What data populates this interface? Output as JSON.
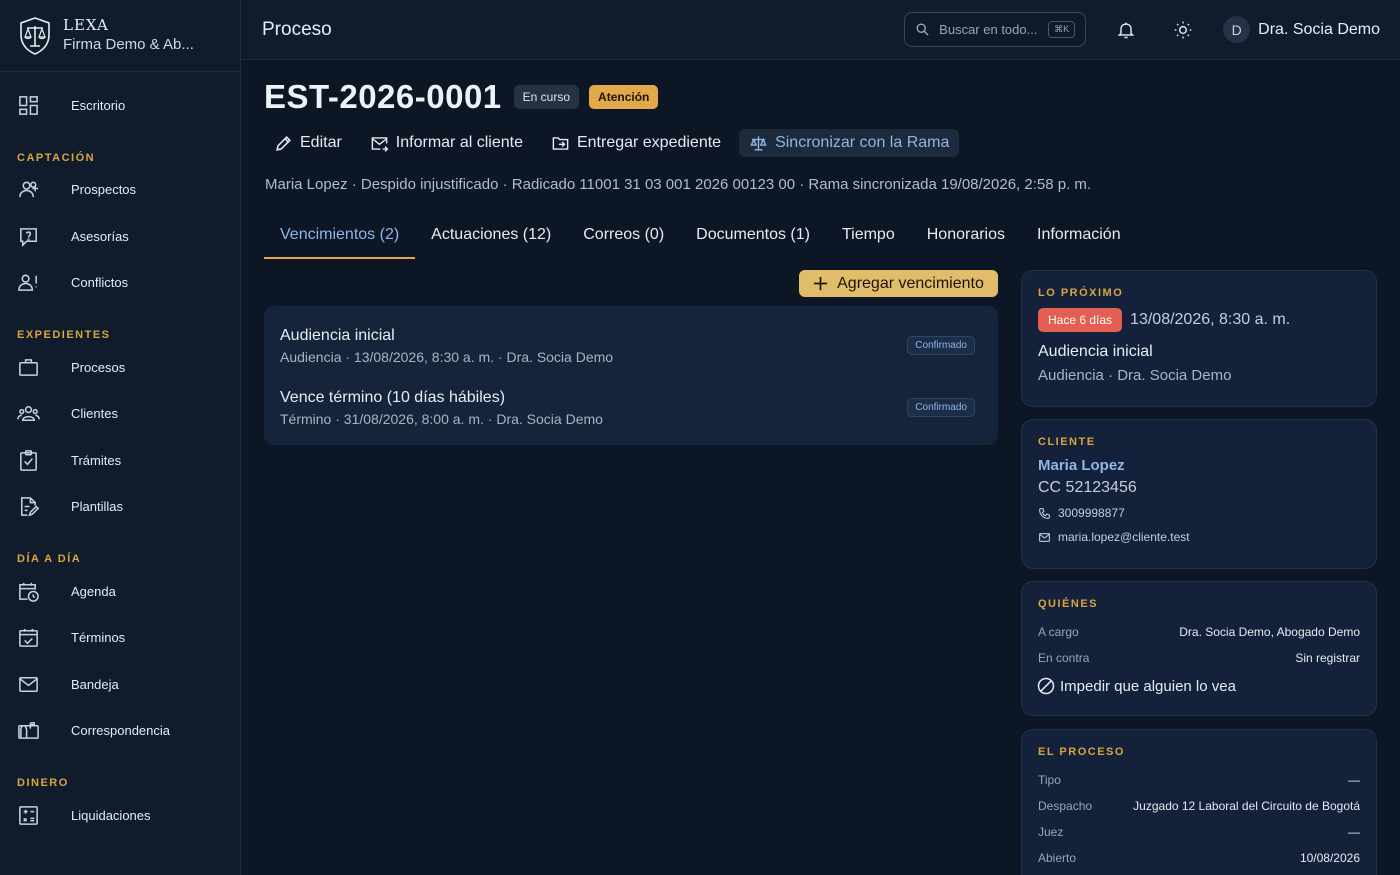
{
  "brand": {
    "name": "LEXA",
    "firm": "Firma Demo & Ab..."
  },
  "sidebar": {
    "top_item": {
      "label": "Escritorio",
      "icon": "dashboard-icon"
    },
    "sections": [
      {
        "title": "CAPTACIÓN",
        "items": [
          {
            "label": "Prospectos",
            "icon": "user-plus-icon"
          },
          {
            "label": "Asesorías",
            "icon": "help-message-icon"
          },
          {
            "label": "Conflictos",
            "icon": "user-alert-icon"
          }
        ]
      },
      {
        "title": "EXPEDIENTES",
        "items": [
          {
            "label": "Procesos",
            "icon": "briefcase-icon"
          },
          {
            "label": "Clientes",
            "icon": "users-icon"
          },
          {
            "label": "Trámites",
            "icon": "clipboard-check-icon"
          },
          {
            "label": "Plantillas",
            "icon": "file-edit-icon"
          }
        ]
      },
      {
        "title": "DÍA A DÍA",
        "items": [
          {
            "label": "Agenda",
            "icon": "calendar-clock-icon"
          },
          {
            "label": "Términos",
            "icon": "calendar-check-icon"
          },
          {
            "label": "Bandeja",
            "icon": "mail-icon"
          },
          {
            "label": "Correspondencia",
            "icon": "mailbox-icon"
          }
        ]
      },
      {
        "title": "DINERO",
        "items": [
          {
            "label": "Liquidaciones",
            "icon": "calculator-icon"
          }
        ]
      }
    ]
  },
  "header": {
    "title": "Proceso",
    "search_placeholder": "Buscar en todo...",
    "search_shortcut": "⌘K",
    "user_initial": "D",
    "user_name": "Dra. Socia Demo"
  },
  "case": {
    "id": "EST-2026-0001",
    "status": "En curso",
    "flag": "Atención",
    "meta": "Maria Lopez · Despido injustificado · Radicado 11001 31 03 001 2026 00123 00 · Rama sincronizada 19/08/2026, 2:58 p. m."
  },
  "actions": {
    "edit": "Editar",
    "inform": "Informar al cliente",
    "deliver": "Entregar expediente",
    "sync": "Sincronizar con la Rama"
  },
  "tabs": [
    "Vencimientos (2)",
    "Actuaciones (12)",
    "Correos (0)",
    "Documentos (1)",
    "Tiempo",
    "Honorarios",
    "Información"
  ],
  "add_deadline_label": "Agregar vencimiento",
  "deadlines": [
    {
      "title": "Audiencia inicial",
      "sub": "Audiencia · 13/08/2026, 8:30 a. m. · Dra. Socia Demo",
      "status": "Confirmado"
    },
    {
      "title": "Vence término (10 días hábiles)",
      "sub": "Término · 31/08/2026, 8:00 a. m. · Dra. Socia Demo",
      "status": "Confirmado"
    }
  ],
  "next": {
    "label": "LO PRÓXIMO",
    "badge": "Hace 6 días",
    "date": "13/08/2026, 8:30 a. m.",
    "title": "Audiencia inicial",
    "sub": "Audiencia · Dra. Socia Demo"
  },
  "client": {
    "label": "CLIENTE",
    "name": "Maria Lopez",
    "id": "CC 52123456",
    "phone": "3009998877",
    "email": "maria.lopez@cliente.test"
  },
  "who": {
    "label": "QUIÉNES",
    "rows": [
      {
        "k": "A cargo",
        "v": "Dra. Socia Demo, Abogado Demo"
      },
      {
        "k": "En contra",
        "v": "Sin registrar"
      }
    ],
    "hide_label": "Impedir que alguien lo vea"
  },
  "process": {
    "label": "EL PROCESO",
    "rows": [
      {
        "k": "Tipo",
        "v": "—"
      },
      {
        "k": "Despacho",
        "v": "Juzgado 12 Laboral del Circuito de Bogotá"
      },
      {
        "k": "Juez",
        "v": "—"
      },
      {
        "k": "Abierto",
        "v": "10/08/2026"
      }
    ]
  },
  "colors": {
    "accent": "#8fb6e6",
    "gold": "#e1a94a",
    "danger": "#e45f53",
    "background": "#0c1624"
  }
}
